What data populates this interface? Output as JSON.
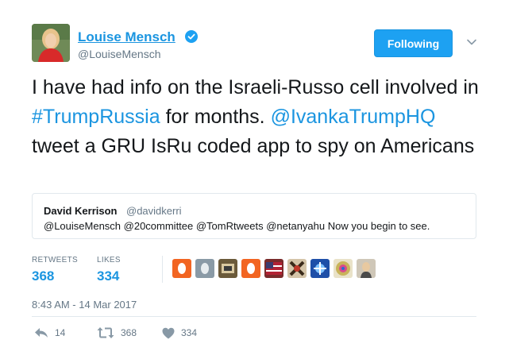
{
  "author": {
    "name": "Louise Mensch",
    "handle": "@LouiseMensch"
  },
  "follow_button": {
    "label": "Following"
  },
  "tweet": {
    "text_parts": {
      "p1": "I have had info on the Israeli-Russo cell involved in ",
      "hashtag": "#TrumpRussia",
      "p2": " for months. ",
      "mention": "@IvankaTrumpHQ",
      "p3": " tweet a GRU IsRu coded app to spy on Americans"
    }
  },
  "quoted": {
    "name": "David Kerrison",
    "handle": "@davidkerri",
    "text": "@LouiseMensch @20committee @TomRtweets @netanyahu Now you begin to see."
  },
  "stats": {
    "retweets_label": "RETWEETS",
    "retweets_value": "368",
    "likes_label": "LIKES",
    "likes_value": "334"
  },
  "timestamp": "8:43 AM - 14 Mar 2017",
  "actions": {
    "reply_count": "14",
    "retweet_count": "368",
    "like_count": "334"
  },
  "colors": {
    "link": "#1b95e0",
    "button": "#1da1f2",
    "muted": "#657786"
  }
}
